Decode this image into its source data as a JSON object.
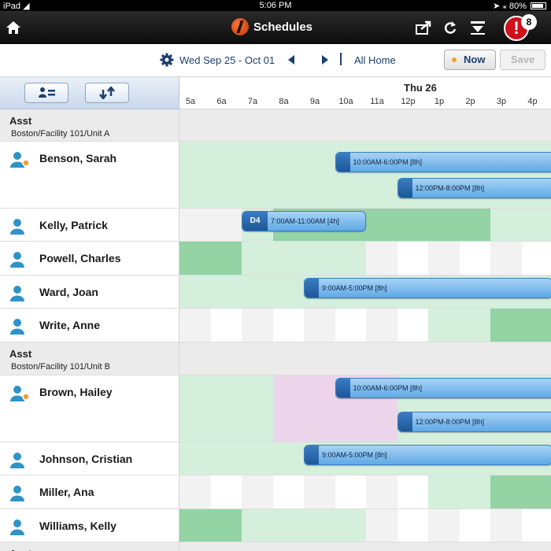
{
  "status_bar": {
    "carrier": "iPad",
    "time": "5:06 PM",
    "battery": "80%"
  },
  "nav": {
    "title": "Schedules",
    "alert_count": "8",
    "alert_symbol": "!",
    "icons": [
      "home-icon",
      "share-icon",
      "refresh-icon",
      "download-icon"
    ]
  },
  "toolbar": {
    "date_range": "Wed Sep 25 - Oct 01",
    "all_home": "All Home",
    "now_label": "Now",
    "save_label": "Save"
  },
  "timeline": {
    "day": "Thu 26",
    "hours": [
      "5a",
      "6a",
      "7a",
      "8a",
      "9a",
      "10a",
      "11a",
      "12p",
      "1p",
      "2p",
      "3p",
      "4p"
    ]
  },
  "colors": {
    "avail_light": "#d4efdc",
    "avail_strong": "#93d3a4",
    "blank": "#ffffff",
    "gray_cell": "#f2f2f2",
    "unavail_pink": "#ecd5ea",
    "shift_blue": "#5fa9e6"
  },
  "groups": [
    {
      "role": "Asst",
      "unit": "Boston/Facility 101/Unit A"
    },
    {
      "role": "Asst",
      "unit": "Boston/Facility 101/Unit B"
    },
    {
      "role": "Asst"
    }
  ],
  "people": [
    {
      "name": "Benson, Sarah",
      "status": "orange-dot",
      "cells": [
        "light",
        "light",
        "light",
        "light",
        "light",
        "light",
        "light",
        "light",
        "light",
        "light",
        "light",
        "light"
      ],
      "shifts": [
        {
          "label": "10:00AM-6:00PM [8h]",
          "start": 10,
          "end": 18
        },
        {
          "label": "12:00PM-8:00PM [8h]",
          "start": 12,
          "end": 20
        }
      ]
    },
    {
      "name": "Kelly, Patrick",
      "cells": [
        "gray",
        "gray",
        "light",
        "strong",
        "strong",
        "strong",
        "strong",
        "strong",
        "strong",
        "strong",
        "light",
        "light"
      ],
      "shifts": [
        {
          "code": "D4",
          "label": "7:00AM-11:00AM [4h]",
          "start": 7,
          "end": 11
        }
      ]
    },
    {
      "name": "Powell, Charles",
      "cells": [
        "strong",
        "strong",
        "light",
        "light",
        "light",
        "light",
        "gray",
        "blank",
        "gray",
        "blank",
        "gray",
        "blank"
      ],
      "shifts": []
    },
    {
      "name": "Ward, Joan",
      "cells": [
        "light",
        "light",
        "light",
        "light",
        "light",
        "light",
        "light",
        "light",
        "light",
        "light",
        "light",
        "light"
      ],
      "shifts": [
        {
          "label": "9:00AM-5:00PM [8h]",
          "start": 9,
          "end": 17
        }
      ]
    },
    {
      "name": "Write, Anne",
      "cells": [
        "gray",
        "blank",
        "gray",
        "blank",
        "gray",
        "blank",
        "gray",
        "blank",
        "light",
        "light",
        "strong",
        "strong"
      ],
      "shifts": []
    },
    {
      "name": "Brown, Hailey",
      "status": "orange-dot",
      "cells": [
        "light",
        "light",
        "light",
        "pink",
        "pink",
        "pink",
        "pink",
        "light",
        "light",
        "light",
        "light",
        "light"
      ],
      "shifts": [
        {
          "label": "10:00AM-6:00PM [8h]",
          "start": 10,
          "end": 18
        },
        {
          "label": "12:00PM-8:00PM [8h]",
          "start": 12,
          "end": 20
        }
      ]
    },
    {
      "name": "Johnson, Cristian",
      "cells": [
        "light",
        "light",
        "light",
        "light",
        "light",
        "light",
        "light",
        "light",
        "light",
        "light",
        "light",
        "light"
      ],
      "shifts": [
        {
          "label": "9:00AM-5:00PM [8h]",
          "start": 9,
          "end": 17
        }
      ]
    },
    {
      "name": "Miller, Ana",
      "cells": [
        "gray",
        "blank",
        "gray",
        "blank",
        "gray",
        "blank",
        "gray",
        "blank",
        "light",
        "light",
        "strong",
        "strong"
      ],
      "shifts": []
    },
    {
      "name": "Williams, Kelly",
      "cells": [
        "strong",
        "strong",
        "light",
        "light",
        "light",
        "light",
        "gray",
        "blank",
        "gray",
        "blank",
        "gray",
        "blank"
      ],
      "shifts": []
    }
  ]
}
